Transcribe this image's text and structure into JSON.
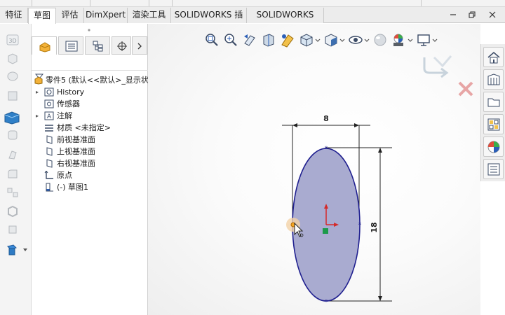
{
  "tabs": [
    {
      "label": "特征",
      "active": false
    },
    {
      "label": "草图",
      "active": true
    },
    {
      "label": "评估",
      "active": false
    },
    {
      "label": "DimXpert",
      "active": false
    },
    {
      "label": "渲染工具",
      "active": false
    },
    {
      "label": "SOLIDWORKS 插件",
      "active": false
    },
    {
      "label": "SOLIDWORKS MBD",
      "active": false
    }
  ],
  "window_controls": {
    "minimize_icon": "minimize-icon",
    "restore_icon": "restore-icon",
    "close_icon": "close-icon"
  },
  "left_toolbar": {
    "first_icon_label": "3D"
  },
  "feature_tree": {
    "filter_icon": "filter-icon",
    "root": "零件5 (默认<<默认>_显示状",
    "items": [
      {
        "label": "History",
        "icon": "history-icon",
        "expandable": true
      },
      {
        "label": "传感器",
        "icon": "sensor-icon",
        "expandable": false
      },
      {
        "label": "注解",
        "icon": "annotation-icon",
        "expandable": true
      },
      {
        "label": "材质 <未指定>",
        "icon": "material-icon",
        "expandable": false
      },
      {
        "label": "前视基准面",
        "icon": "plane-icon",
        "expandable": false
      },
      {
        "label": "上视基准面",
        "icon": "plane-icon",
        "expandable": false
      },
      {
        "label": "右视基准面",
        "icon": "plane-icon",
        "expandable": false
      },
      {
        "label": "原点",
        "icon": "origin-icon",
        "expandable": false
      },
      {
        "label": "(-) 草图1",
        "icon": "sketch-icon",
        "expandable": false
      }
    ]
  },
  "sketch": {
    "dim_width": "8",
    "dim_height": "18",
    "fill_color": "#a9abd0",
    "outline_color": "#1f1f8f"
  },
  "colors": {
    "accent": "#2b5fb8",
    "cancel": "#e25b5b",
    "confirm_grey": "#c8d3dc"
  }
}
